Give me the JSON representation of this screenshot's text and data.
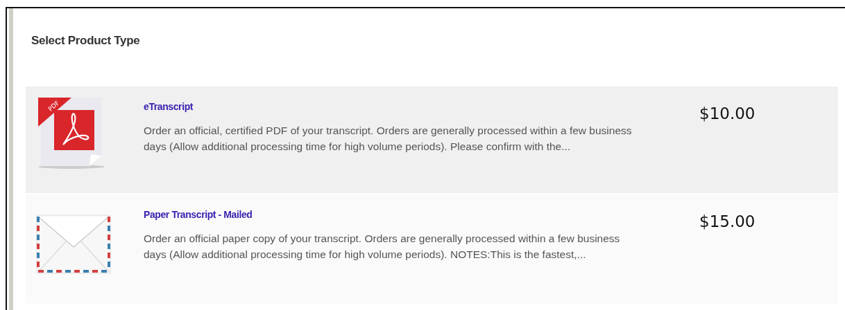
{
  "heading": "Select Product Type",
  "products": [
    {
      "kind": "pdf",
      "icon_label": "PDF",
      "title": "eTranscript",
      "description": "Order an official, certified PDF of your transcript. Orders are generally processed within a few business days (Allow additional processing time for high volume periods). Please confirm with the...",
      "price": "$10.00"
    },
    {
      "kind": "mail",
      "title": "Paper Transcript - Mailed",
      "description": "Order an official paper copy of your transcript. Orders are generally processed within a few business days (Allow additional processing time for high volume periods).  NOTES:This is the fastest,...",
      "price": "$15.00"
    }
  ]
}
